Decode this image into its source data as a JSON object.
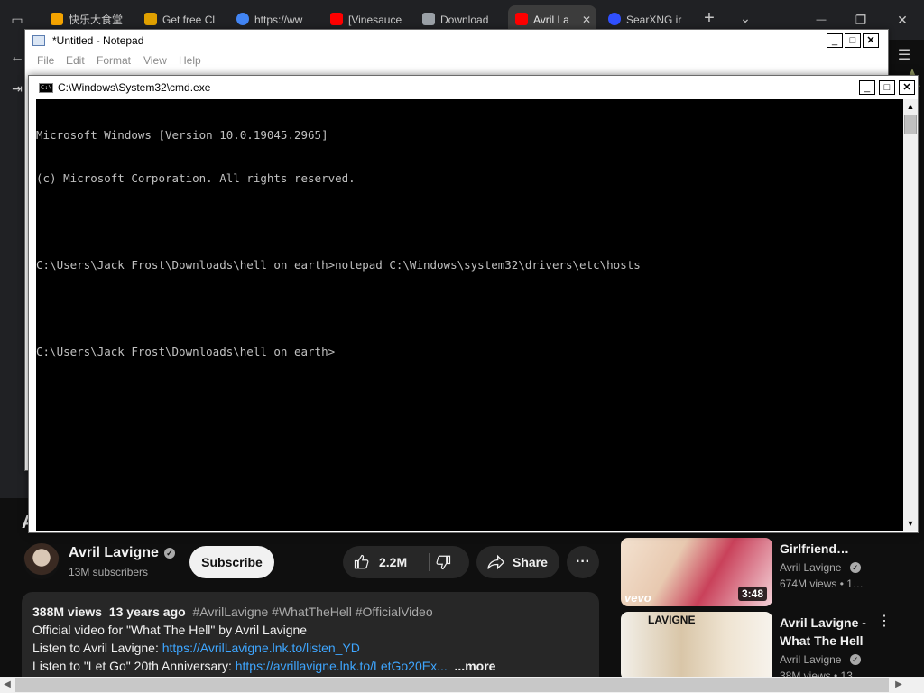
{
  "browser": {
    "tabs": [
      {
        "label": "快乐大食堂",
        "fav_color": "#f4a300"
      },
      {
        "label": "Get free Cl",
        "fav_color": "#e0a000"
      },
      {
        "label": "https://ww",
        "fav_color": "#4285f4"
      },
      {
        "label": "[Vinesauce",
        "fav_color": "#ff0000"
      },
      {
        "label": "Download",
        "fav_color": "#9aa0a6"
      },
      {
        "label": "Avril La",
        "fav_color": "#ff0000"
      },
      {
        "label": "SearXNG ir",
        "fav_color": "#3050ff"
      }
    ],
    "new_tab": "+",
    "tab_list": "⌄",
    "minimize": "—",
    "restore": "❐",
    "close": "✕",
    "menu": "☰"
  },
  "notepad": {
    "title": "*Untitled - Notepad",
    "menu": [
      "File",
      "Edit",
      "Format",
      "View",
      "Help"
    ]
  },
  "cmd": {
    "title": "C:\\Windows\\System32\\cmd.exe",
    "icon_text": "C:\\",
    "lines": [
      "Microsoft Windows [Version 10.0.19045.2965]",
      "(c) Microsoft Corporation. All rights reserved.",
      "",
      "C:\\Users\\Jack Frost\\Downloads\\hell on earth>notepad C:\\Windows\\system32\\drivers\\etc\\hosts",
      "",
      "C:\\Users\\Jack Frost\\Downloads\\hell on earth>"
    ]
  },
  "youtube": {
    "title_fragment": "A",
    "channel": "Avril Lavigne",
    "subscribers": "13M subscribers",
    "subscribe": "Subscribe",
    "likes": "2.2M",
    "share": "Share",
    "more_actions": "···",
    "description": {
      "views": "388M views",
      "age": "13 years ago",
      "hashtags": "#AvrilLavigne #WhatTheHell #OfficialVideo",
      "line1": "Official video for \"What The Hell\" by Avril Lavigne",
      "line2_prefix": "Listen to Avril Lavigne: ",
      "line2_link": "https://AvrilLavigne.lnk.to/listen_YD",
      "line3_prefix": "Listen to \"Let Go\" 20th Anniversary: ",
      "line3_link": "https://avrillavigne.lnk.to/LetGo20Ex...",
      "more": "...more"
    },
    "related": [
      {
        "title": "Girlfriend…",
        "channel": "Avril Lavigne",
        "views": "674M views • 1…",
        "duration": "3:48",
        "badge": "vevo"
      },
      {
        "title": "Avril Lavigne - What The Hell",
        "channel": "Avril Lavigne",
        "views": "38M views • 13",
        "duration": "",
        "badge": "LAVIGNE"
      }
    ]
  }
}
